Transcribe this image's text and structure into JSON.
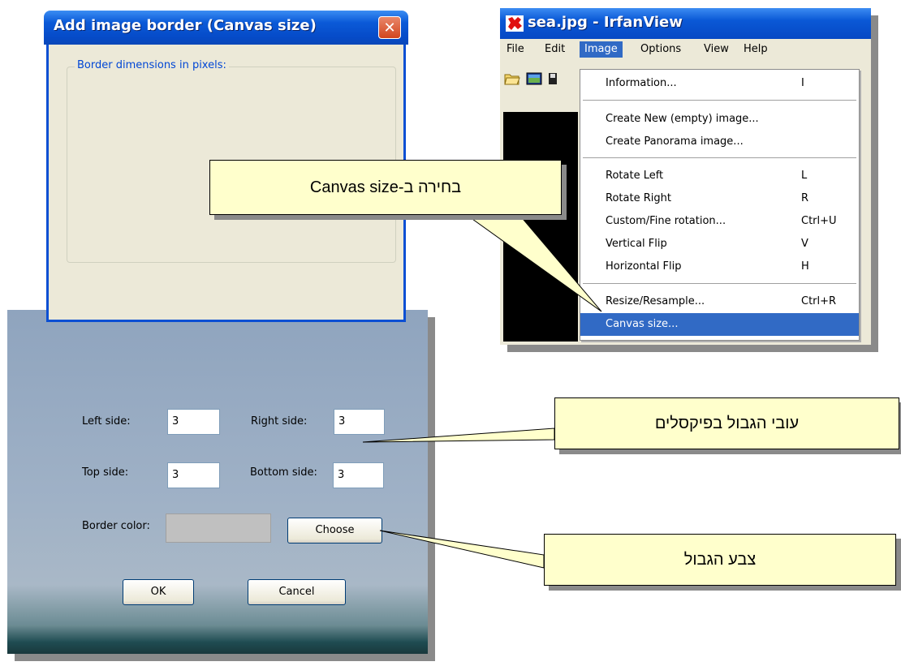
{
  "irfanview": {
    "title": "sea.jpg - IrfanView",
    "menu": [
      "File",
      "Edit",
      "Image",
      "Options",
      "View",
      "Help"
    ],
    "active_menu": "Image",
    "image_menu": [
      {
        "label": "Information...",
        "key": "I"
      },
      {
        "label": "Create New (empty) image...",
        "key": ""
      },
      {
        "label": "Create Panorama image...",
        "key": ""
      },
      {
        "label": "Rotate Left",
        "key": "L"
      },
      {
        "label": "Rotate Right",
        "key": "R"
      },
      {
        "label": "Custom/Fine rotation...",
        "key": "Ctrl+U"
      },
      {
        "label": "Vertical Flip",
        "key": "V"
      },
      {
        "label": "Horizontal Flip",
        "key": "H"
      },
      {
        "label": "Resize/Resample...",
        "key": "Ctrl+R"
      },
      {
        "label": "Canvas size...",
        "key": ""
      }
    ],
    "highlighted_item": "Canvas size..."
  },
  "dialog": {
    "title": "Add image border (Canvas size)",
    "close_symbol": "✕",
    "group_label": "Border dimensions in pixels:",
    "left_label": "Left side:",
    "left_value": "3",
    "right_label": "Right side:",
    "right_value": "3",
    "top_label": "Top side:",
    "top_value": "3",
    "bottom_label": "Bottom side:",
    "bottom_value": "3",
    "color_label": "Border color:",
    "border_color": "#c0c0c0",
    "choose_label": "Choose",
    "ok_label": "OK",
    "cancel_label": "Cancel"
  },
  "callouts": {
    "canvas": "בחירה ב-Canvas size",
    "thickness": "עובי הגבול בפיקסלים",
    "color": "צבע הגבול"
  },
  "colors": {
    "callout_bg": "#ffffcc",
    "xp_title": "#0a58d6",
    "menu_highlight": "#316ac5"
  }
}
